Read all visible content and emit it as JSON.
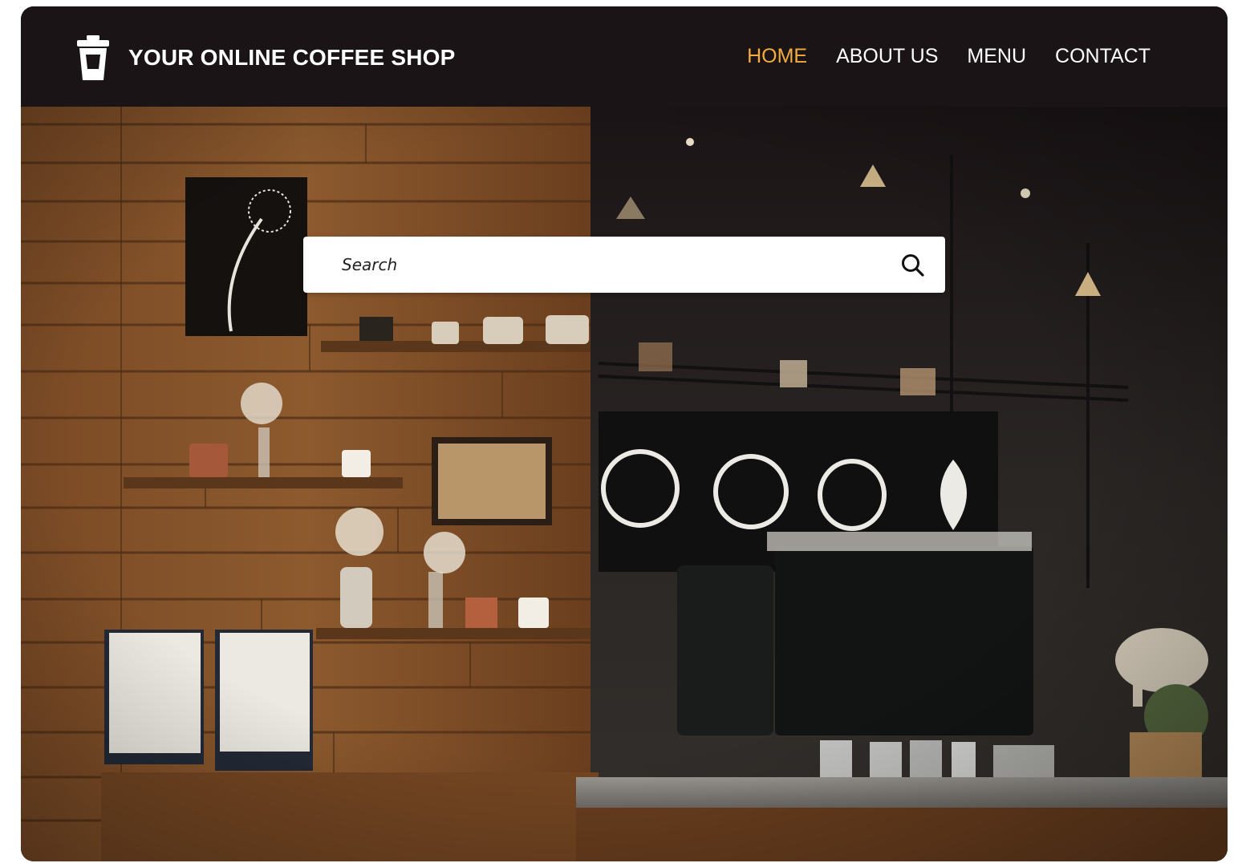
{
  "header": {
    "brand_title": "YOUR ONLINE COFFEE SHOP",
    "brand_icon": "coffee-cup-icon"
  },
  "nav": {
    "items": [
      {
        "label": "HOME",
        "active": true
      },
      {
        "label": "ABOUT US",
        "active": false
      },
      {
        "label": "MENU",
        "active": false
      },
      {
        "label": "CONTACT",
        "active": false
      }
    ]
  },
  "search": {
    "placeholder": "Search",
    "icon": "search-icon"
  },
  "hero": {
    "image": "coffee-shop-interior-photo"
  },
  "colors": {
    "navbar_background": "#1b1416",
    "nav_active": "#f3ac3d",
    "nav_text": "#ffffff"
  }
}
